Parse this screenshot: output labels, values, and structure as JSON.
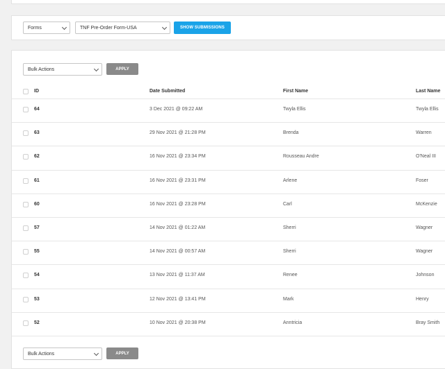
{
  "filter": {
    "forms_select": "Forms",
    "form_select": "TNF Pre-Order Form-USA",
    "show_button": "SHOW SUBMISSIONS"
  },
  "bulk_top": {
    "select": "Bulk Actions",
    "apply": "APPLY"
  },
  "bulk_bottom": {
    "select": "Bulk Actions",
    "apply": "APPLY"
  },
  "table": {
    "headers": {
      "id": "ID",
      "date": "Date Submitted",
      "first": "First Name",
      "last": "Last Name"
    },
    "rows": [
      {
        "id": "64",
        "date": "3 Dec 2021 @ 09:22 AM",
        "first": "Twyla Ellis",
        "last": "Twyla Ellis"
      },
      {
        "id": "63",
        "date": "29 Nov 2021 @ 21:28 PM",
        "first": "Brenda",
        "last": "Warren"
      },
      {
        "id": "62",
        "date": "16 Nov 2021 @ 23:34 PM",
        "first": "Rousseau Andre",
        "last": "O'Neal III"
      },
      {
        "id": "61",
        "date": "16 Nov 2021 @ 23:31 PM",
        "first": "Arlene",
        "last": "Foser"
      },
      {
        "id": "60",
        "date": "16 Nov 2021 @ 23:28 PM",
        "first": "Carl",
        "last": "McKenzie"
      },
      {
        "id": "57",
        "date": "14 Nov 2021 @ 01:22 AM",
        "first": "Sherri",
        "last": "Wagner"
      },
      {
        "id": "55",
        "date": "14 Nov 2021 @ 00:57 AM",
        "first": "Sherri",
        "last": "Wagner"
      },
      {
        "id": "54",
        "date": "13 Nov 2021 @ 11:37 AM",
        "first": "Renee",
        "last": "Johnson"
      },
      {
        "id": "53",
        "date": "12 Nov 2021 @ 13:41 PM",
        "first": "Mark",
        "last": "Henry"
      },
      {
        "id": "52",
        "date": "10 Nov 2021 @ 20:38 PM",
        "first": "Anntricia",
        "last": "Bray Smith"
      }
    ]
  },
  "colors": {
    "accent": "#1aa3e8",
    "apply_button": "#8a8a8a",
    "background": "#f1f1f1"
  }
}
